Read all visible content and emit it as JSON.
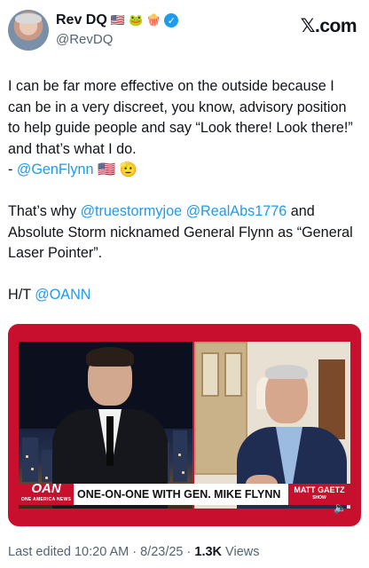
{
  "author": {
    "display_name": "Rev DQ",
    "name_emojis": [
      "🇺🇸",
      "🐸",
      "🍿"
    ],
    "verified_icon": "verified-badge-icon",
    "handle": "@RevDQ"
  },
  "brand": "𝕏.com",
  "tweet": {
    "line1": "I can be far more effective on the outside because I can be in a very discreet, you know, advisory position to help guide people and say “Look there! Look there!” and that’s what I do.",
    "line2_prefix": "- ",
    "line2_mention": "@GenFlynn",
    "line2_emojis": "🇺🇸 🫡",
    "p2_start": "That’s why ",
    "p2_mention1": "@truestormyjoe",
    "p2_mention2": "@RealAbs1776",
    "p2_end": " and Absolute Storm nicknamed General Flynn as “General Laser Pointer”.",
    "ht_prefix": "H/T ",
    "ht_mention": "@OANN"
  },
  "video": {
    "network_logo": "OAN",
    "network_sub": "ONE AMERICA NEWS",
    "chyron": "ONE-ON-ONE WITH GEN. MIKE FLYNN",
    "show_badge": "MATT GAETZ",
    "show_badge_sub": "SHOW",
    "volume_icon": "volume-icon",
    "volume_glyph": "🔈"
  },
  "meta": {
    "edited_label": "Last edited 10:20 AM · 8/23/25 · ",
    "views_count": "1.3K",
    "views_label": " Views"
  },
  "colors": {
    "mention": "#1d9bf0",
    "verified": "#1d9bf0",
    "oan_red": "#c8102e"
  }
}
